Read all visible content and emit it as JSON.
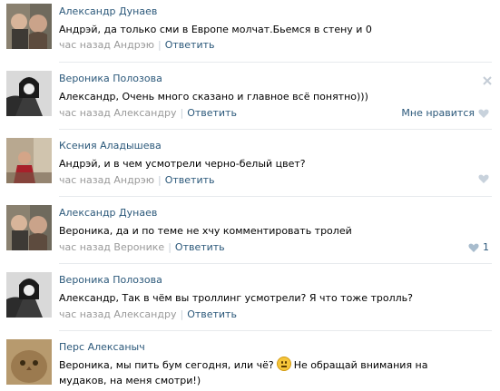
{
  "colors": {
    "link": "#2b587a",
    "meta": "#999999",
    "separator": "#e7eaed",
    "heart": "#c8d2dc"
  },
  "comments": [
    {
      "author": "Александр Дунаев",
      "text": "Андрэй, да только сми в Европе молчат.Бьемся в стену и 0",
      "time": "час назад Андрэю",
      "divider": "|",
      "reply": "Ответить"
    },
    {
      "author": "Вероника Полозова",
      "text": "Александр, Очень много сказано и главное всё понятно)))",
      "time": "час назад Александру",
      "divider": "|",
      "reply": "Ответить",
      "like_label": "Мне нравится",
      "close_icon": "close-icon"
    },
    {
      "author": "Ксения Аладышева",
      "text": "Андрэй, и в чем усмотрели черно-белый цвет?",
      "time": "час назад Андрэю",
      "divider": "|",
      "reply": "Ответить"
    },
    {
      "author": "Александр Дунаев",
      "text": "Вероника, да и по теме не хчу комментировать тролей",
      "time": "час назад Веронике",
      "divider": "|",
      "reply": "Ответить",
      "like_count": "1"
    },
    {
      "author": "Вероника Полозова",
      "text": "Александр, Так в чём вы троллинг усмотрели? Я что тоже тролль?",
      "time": "час назад Александру",
      "divider": "|",
      "reply": "Ответить"
    },
    {
      "author": "Перс Алексаныч",
      "text_before": "Вероника, мы пить бум сегодня, или чё?",
      "text_after": "Не обращай внимания на мудаков, на меня смотри!)",
      "emoji": "confused-face-emoji"
    }
  ]
}
